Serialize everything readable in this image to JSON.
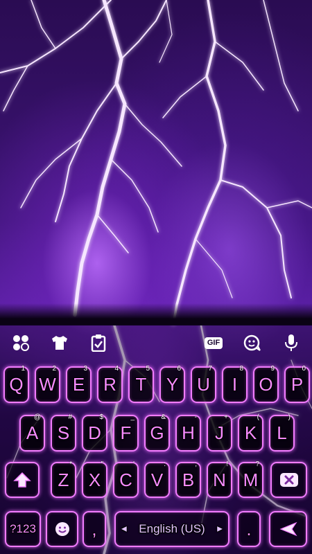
{
  "toolbar": {
    "icons": [
      "grid-icon",
      "tshirt-icon",
      "clipboard-icon",
      "gif-icon",
      "emoji-sticker-icon",
      "microphone-icon"
    ],
    "gif_label": "GIF"
  },
  "keyboard": {
    "row1": [
      {
        "label": "Q",
        "hint": "1"
      },
      {
        "label": "W",
        "hint": "2"
      },
      {
        "label": "E",
        "hint": "3"
      },
      {
        "label": "R",
        "hint": "4"
      },
      {
        "label": "T",
        "hint": "5"
      },
      {
        "label": "Y",
        "hint": "6"
      },
      {
        "label": "U",
        "hint": "7"
      },
      {
        "label": "I",
        "hint": "8"
      },
      {
        "label": "O",
        "hint": "9"
      },
      {
        "label": "P",
        "hint": "0"
      }
    ],
    "row2": [
      {
        "label": "A",
        "hint": "@"
      },
      {
        "label": "S",
        "hint": "#"
      },
      {
        "label": "D",
        "hint": "$"
      },
      {
        "label": "F",
        "hint": "_"
      },
      {
        "label": "G",
        "hint": "&"
      },
      {
        "label": "H",
        "hint": "-"
      },
      {
        "label": "J",
        "hint": "+"
      },
      {
        "label": "K",
        "hint": "("
      },
      {
        "label": "L",
        "hint": ")"
      }
    ],
    "row3": [
      {
        "label": "Z",
        "hint": "*"
      },
      {
        "label": "X",
        "hint": "\""
      },
      {
        "label": "C",
        "hint": "'"
      },
      {
        "label": "V",
        "hint": ":"
      },
      {
        "label": "B",
        "hint": ";"
      },
      {
        "label": "N",
        "hint": "!"
      },
      {
        "label": "M",
        "hint": "?"
      }
    ],
    "symbols_key": "?123",
    "comma_key": ",",
    "space_label": "English (US)",
    "period_key": "."
  },
  "colors": {
    "key_border": "#f27cff",
    "key_text": "#f78bff",
    "wallpaper_purple": "#5a1fa3"
  }
}
